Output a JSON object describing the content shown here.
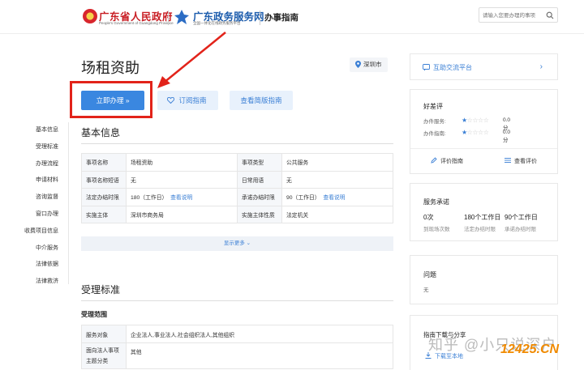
{
  "header": {
    "gov_name": "广东省人民政府",
    "gov_en": "People's Government of Guangdong Province",
    "service_name": "广东政务服务网",
    "service_sub": "全国一体化在线政务服务平台",
    "section": "办事指南",
    "search_placeholder": "请输入您要办理的事项"
  },
  "page": {
    "title": "场租资助",
    "location": "深圳市",
    "buttons": {
      "apply": "立即办理 »",
      "subscribe": "订阅指南",
      "brief": "查看简版指南"
    }
  },
  "left_nav": [
    "基本信息",
    "受理标准",
    "办理流程",
    "申请材料",
    "咨询监督",
    "窗口办理",
    "收费项目信息",
    "中介服务",
    "法律依据",
    "法律救济"
  ],
  "basic_info": {
    "title": "基本信息",
    "rows": [
      [
        "事项名称",
        "场租资助",
        "事项类型",
        "公共服务"
      ],
      [
        "事项名称短语",
        "无",
        "日常用语",
        "无"
      ],
      [
        "法定办结时限",
        "180（工作日）",
        "承诺办结时限",
        "90（工作日）"
      ],
      [
        "实施主体",
        "深圳市商务局",
        "实施主体性质",
        "法定机关"
      ]
    ],
    "view_link": "查看说明",
    "show_more": "显示更多 ⌄"
  },
  "acceptance": {
    "title": "受理标准",
    "scope_title": "受理范围",
    "rows": [
      [
        "服务对象",
        "企业法人,事业法人,社会组织法人,其他组织"
      ],
      [
        "面向法人事项主题分类",
        "其他"
      ]
    ]
  },
  "sidebar": {
    "interaction": "互助交流平台",
    "rating": {
      "title": "好差评",
      "rows": [
        {
          "label": "办件服务:",
          "score": "0.0分"
        },
        {
          "label": "办件指南:",
          "score": "0.0分"
        }
      ],
      "rate_action": "评价指南",
      "view_action": "查看评价"
    },
    "promise": {
      "title": "服务承诺",
      "items": [
        {
          "value": "0次",
          "label": "到现场次数"
        },
        {
          "value": "180个工作日",
          "label": "法定办结时限"
        },
        {
          "value": "90个工作日",
          "label": "承诺办结时限"
        }
      ]
    },
    "questions": {
      "title": "问题",
      "value": "无"
    },
    "download": {
      "title": "指南下载与分享",
      "link": "下载至本地"
    }
  },
  "overlay": {
    "watermark": "知乎 @小只说深户",
    "site": "12425.CN"
  },
  "colors": {
    "primary": "#3a87e0",
    "annotation": "#e2231a",
    "gov_red": "#c81d23"
  }
}
